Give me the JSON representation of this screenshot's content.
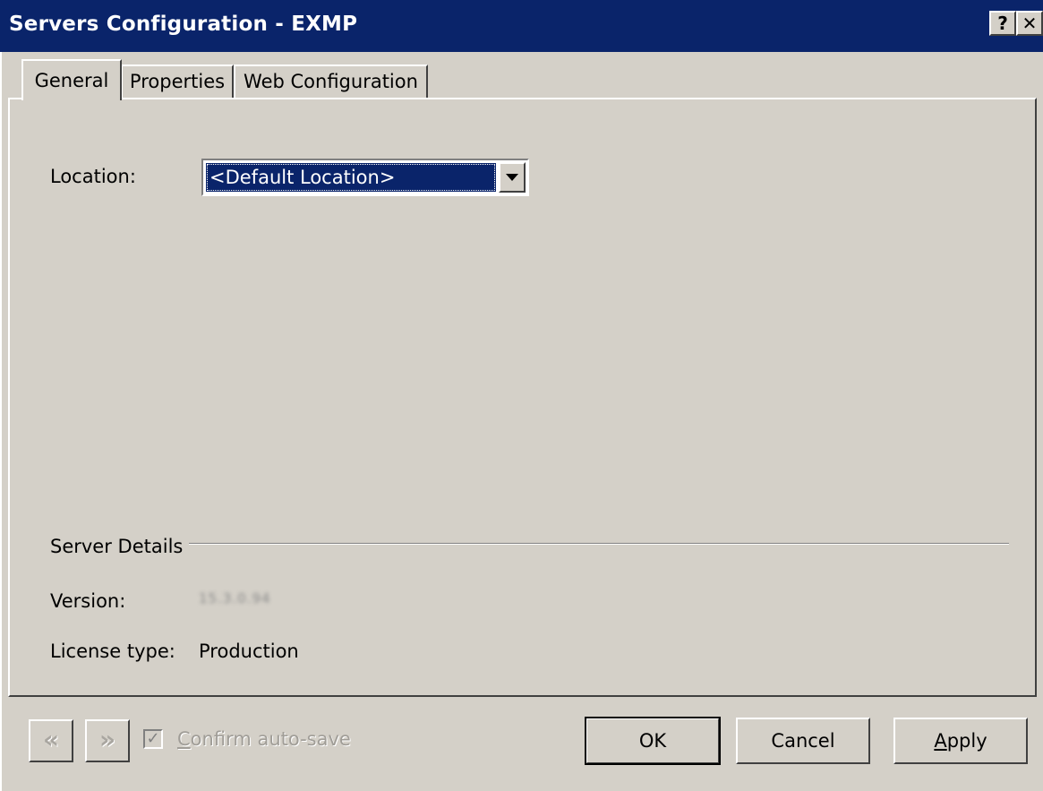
{
  "window": {
    "title": "Servers Configuration - EXMP",
    "help_glyph": "?",
    "close_glyph": "✕"
  },
  "tabs": [
    {
      "label": "General",
      "selected": true
    },
    {
      "label": "Properties",
      "selected": false
    },
    {
      "label": "Web Configuration",
      "selected": false
    }
  ],
  "general": {
    "location_label": "Location:",
    "location_value": "<Default Location>"
  },
  "server_details": {
    "section_label": "Server Details",
    "version_label": "Version:",
    "version_value": "15.3.0.94",
    "license_label": "License type:",
    "license_value": "Production"
  },
  "footer": {
    "prev_glyph": "«",
    "next_glyph": "»",
    "confirm_auto_save": {
      "accel": "C",
      "rest": "onfirm auto-save",
      "checked": true,
      "enabled": false
    },
    "ok_label": "OK",
    "cancel_label": "Cancel",
    "apply_accel": "A",
    "apply_rest": "pply"
  },
  "colors": {
    "titlebar": "#0a246a",
    "face": "#d4d0c8",
    "selection": "#0a246a"
  }
}
